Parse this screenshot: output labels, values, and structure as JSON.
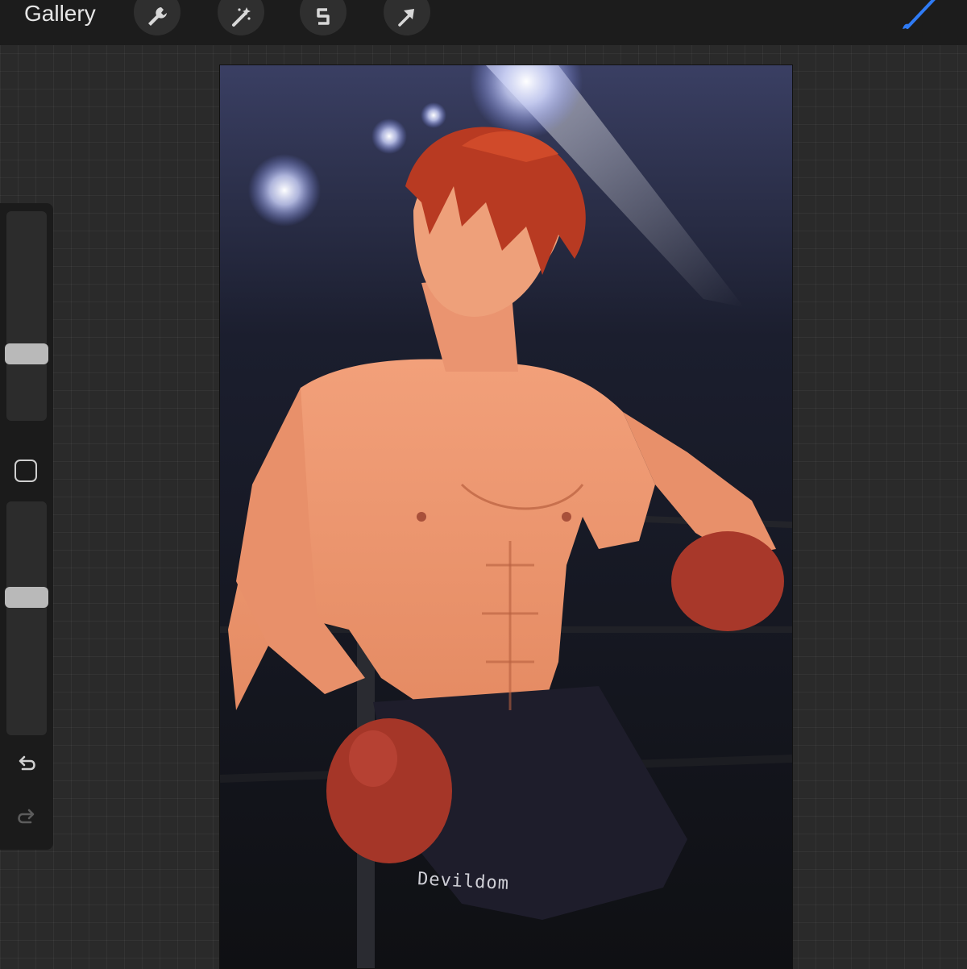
{
  "toolbar": {
    "gallery_label": "Gallery",
    "tools": [
      {
        "name": "actions",
        "icon": "wrench-icon"
      },
      {
        "name": "adjustments",
        "icon": "magic-wand-icon"
      },
      {
        "name": "selection",
        "icon": "selection-s-icon"
      },
      {
        "name": "transform",
        "icon": "arrow-icon"
      }
    ],
    "brush_icon": "brush-icon",
    "accent_color": "#2f7bf5"
  },
  "sidebar": {
    "brush_size": 0.3,
    "brush_opacity": 0.6,
    "modify_icon": "square-icon",
    "undo_icon": "undo-icon",
    "redo_icon": "redo-icon"
  },
  "canvas": {
    "watermark_text": "Devildom"
  }
}
